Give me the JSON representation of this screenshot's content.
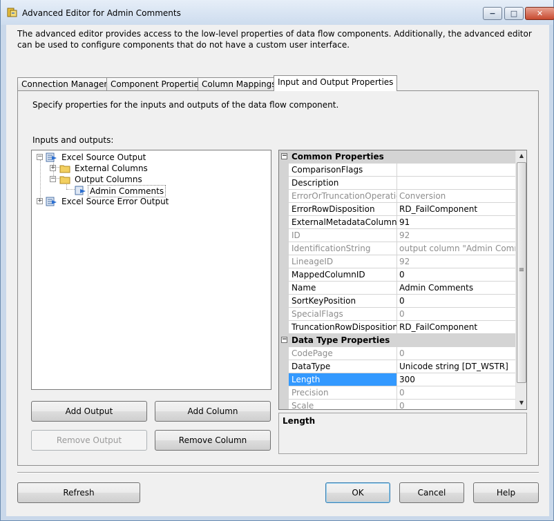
{
  "window": {
    "title": "Advanced Editor for Admin Comments",
    "minimize": "−",
    "maximize": "□",
    "close": "✕"
  },
  "description": "The advanced editor provides access to the low-level properties of data flow components. Additionally, the advanced editor can be used to configure components that do not have a custom user interface.",
  "tabs": [
    {
      "label": "Connection Managers"
    },
    {
      "label": "Component Properties"
    },
    {
      "label": "Column Mappings"
    },
    {
      "label": "Input and Output Properties"
    }
  ],
  "panel": {
    "instructions": "Specify properties for the inputs and outputs of the data flow component.",
    "inputs_label": "Inputs and outputs:"
  },
  "tree": [
    {
      "label": "Excel Source Output",
      "expander": "−"
    },
    {
      "label": "External Columns",
      "expander": "+"
    },
    {
      "label": "Output Columns",
      "expander": "−"
    },
    {
      "label": "Admin Comments"
    },
    {
      "label": "Excel Source Error Output",
      "expander": "+"
    }
  ],
  "buttons": {
    "add_output": "Add Output",
    "add_column": "Add Column",
    "remove_output": "Remove Output",
    "remove_column": "Remove Column",
    "refresh": "Refresh",
    "ok": "OK",
    "cancel": "Cancel",
    "help": "Help"
  },
  "property_grid": {
    "common_category": "Common Properties",
    "common_rows": [
      {
        "name": "ComparisonFlags",
        "value": "",
        "readonly": false
      },
      {
        "name": "Description",
        "value": "",
        "readonly": false
      },
      {
        "name": "ErrorOrTruncationOperation",
        "value": "Conversion",
        "readonly": true
      },
      {
        "name": "ErrorRowDisposition",
        "value": "RD_FailComponent",
        "readonly": false
      },
      {
        "name": "ExternalMetadataColumnID",
        "value": "91",
        "readonly": false
      },
      {
        "name": "ID",
        "value": "92",
        "readonly": true
      },
      {
        "name": "IdentificationString",
        "value": "output column \"Admin Comme",
        "readonly": true
      },
      {
        "name": "LineageID",
        "value": "92",
        "readonly": true
      },
      {
        "name": "MappedColumnID",
        "value": "0",
        "readonly": false
      },
      {
        "name": "Name",
        "value": "Admin Comments",
        "readonly": false
      },
      {
        "name": "SortKeyPosition",
        "value": "0",
        "readonly": false
      },
      {
        "name": "SpecialFlags",
        "value": "0",
        "readonly": true
      },
      {
        "name": "TruncationRowDisposition",
        "value": "RD_FailComponent",
        "readonly": false
      }
    ],
    "datatype_category": "Data Type Properties",
    "datatype_rows": [
      {
        "name": "CodePage",
        "value": "0",
        "readonly": true
      },
      {
        "name": "DataType",
        "value": "Unicode string [DT_WSTR]",
        "readonly": false
      },
      {
        "name": "Length",
        "value": "300",
        "readonly": false,
        "selected": true
      },
      {
        "name": "Precision",
        "value": "0",
        "readonly": true
      },
      {
        "name": "Scale",
        "value": "0",
        "readonly": true
      }
    ],
    "help_title": "Length",
    "scroll_up": "▲",
    "scroll_down": "▼",
    "scroll_grip": "≡"
  },
  "colors": {
    "selection": "#3399ff",
    "readonly_text": "#8d8d8d",
    "category_bg": "#d4d4d4"
  }
}
